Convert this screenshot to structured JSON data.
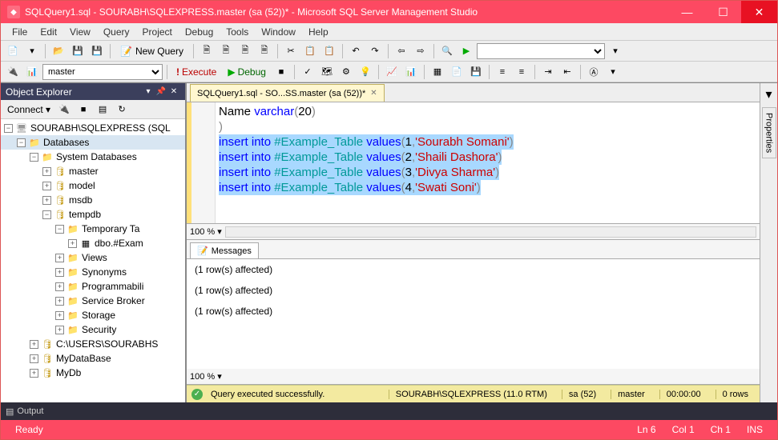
{
  "window": {
    "title": "SQLQuery1.sql - SOURABH\\SQLEXPRESS.master (sa (52))* - Microsoft SQL Server Management Studio"
  },
  "menu": [
    "File",
    "Edit",
    "View",
    "Query",
    "Project",
    "Debug",
    "Tools",
    "Window",
    "Help"
  ],
  "toolbar1": {
    "new_query": "New Query"
  },
  "toolbar2": {
    "db_combo": "master",
    "execute": "Execute",
    "debug": "Debug"
  },
  "object_explorer": {
    "title": "Object Explorer",
    "connect": "Connect",
    "tree": {
      "server": "SOURABH\\SQLEXPRESS (SQL",
      "databases": "Databases",
      "system_databases": "System Databases",
      "dbs": [
        "master",
        "model",
        "msdb",
        "tempdb"
      ],
      "tempdb_children": {
        "temporary_tables": "Temporary Ta",
        "table": "dbo.#Exam"
      },
      "sys_folders": [
        "Views",
        "Synonyms",
        "Programmabili",
        "Service Broker",
        "Storage",
        "Security"
      ],
      "users_path": "C:\\USERS\\SOURABHS",
      "user_dbs": [
        "MyDataBase",
        "MyDb"
      ]
    }
  },
  "doc_tab": "SQLQuery1.sql - SO...SS.master (sa (52))*",
  "code": {
    "l1_a": "Name ",
    "l1_b": "varchar",
    "l1_c": "(",
    "l1_d": "20",
    "l1_e": ")",
    "l2": ")",
    "ins": "insert",
    "into": "into",
    "tbl": "#Example_Table",
    "vals": "values",
    "r1_n": "1",
    "r1_s": "'Sourabh Somani'",
    "r2_n": "2",
    "r2_s": "'Shaili Dashora'",
    "r3_n": "3",
    "r3_s": "'Divya Sharma'",
    "r4_n": "4",
    "r4_s": "'Swati Soni'"
  },
  "zoom": "100 %",
  "messages": {
    "tab": "Messages",
    "lines": [
      "(1 row(s) affected)",
      "(1 row(s) affected)",
      "(1 row(s) affected)"
    ]
  },
  "exec_status": {
    "text": "Query executed successfully.",
    "server": "SOURABH\\SQLEXPRESS (11.0 RTM)",
    "user": "sa (52)",
    "db": "master",
    "time": "00:00:00",
    "rows": "0 rows"
  },
  "output_tab": "Output",
  "status": {
    "ready": "Ready",
    "ln": "Ln 6",
    "col": "Col 1",
    "ch": "Ch 1",
    "ins": "INS"
  },
  "side_panel": "Properties"
}
